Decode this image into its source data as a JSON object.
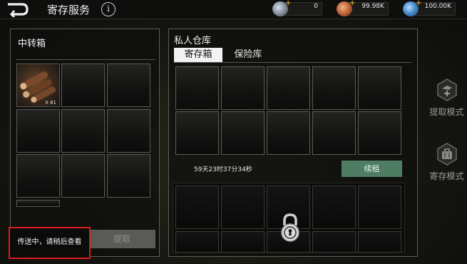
{
  "header": {
    "title": "寄存服务",
    "info_label": "i",
    "currencies": [
      {
        "icon": "silver-coin-icon",
        "value": "0",
        "color": "#9aa6b2"
      },
      {
        "icon": "copper-coin-icon",
        "value": "99.98K",
        "color": "#c46a3a"
      },
      {
        "icon": "blue-orb-icon",
        "value": "100.00K",
        "color": "#4a8fd0"
      }
    ],
    "plus_label": "+"
  },
  "transfer_box": {
    "title": "中转箱",
    "item": {
      "name": "wood-logs",
      "quantity": "X 61"
    },
    "extract_label": "提取"
  },
  "toast": {
    "text": "传送中，请稍后查看"
  },
  "private_storage": {
    "title": "私人仓库",
    "tabs": [
      {
        "label": "寄存箱",
        "active": true
      },
      {
        "label": "保险库",
        "active": false
      }
    ],
    "timer": "59天23时37分34秒",
    "renew_label": "续租"
  },
  "side_modes": [
    {
      "label": "提取模式",
      "icon": "extract-mode-icon"
    },
    {
      "label": "寄存模式",
      "icon": "deposit-mode-icon"
    }
  ]
}
